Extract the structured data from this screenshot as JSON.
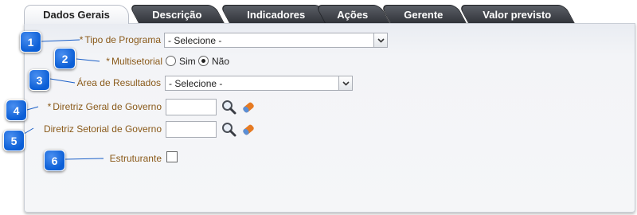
{
  "tabs": [
    {
      "label": "Dados Gerais",
      "active": true
    },
    {
      "label": "Descrição"
    },
    {
      "label": "Indicadores"
    },
    {
      "label": "Ações"
    },
    {
      "label": "Gerente"
    },
    {
      "label": "Valor previsto"
    }
  ],
  "form": {
    "tipo_programa": {
      "required_mark": "*",
      "label": "Tipo de Programa",
      "value": "- Selecione -"
    },
    "multisetorial": {
      "required_mark": "*",
      "label": "Multisetorial",
      "options": [
        "Sim",
        "Não"
      ],
      "selected": "Não"
    },
    "area_resultados": {
      "label": "Área de Resultados",
      "value": "- Selecione -"
    },
    "diretriz_geral": {
      "required_mark": "*",
      "label": "Diretriz Geral de Governo",
      "value": ""
    },
    "diretriz_setorial": {
      "label": "Diretriz Setorial de Governo",
      "value": ""
    },
    "estruturante": {
      "label": "Estruturante",
      "checked": false
    }
  },
  "callouts": [
    "1",
    "2",
    "3",
    "4",
    "5",
    "6"
  ],
  "icons": {
    "search": "search-icon",
    "eraser": "eraser-icon",
    "dropdown": "chevron-down-icon"
  },
  "colors": {
    "label": "#8a5a1a",
    "badge": "#0c5fd6",
    "tab_dark": "#3a3d44"
  }
}
